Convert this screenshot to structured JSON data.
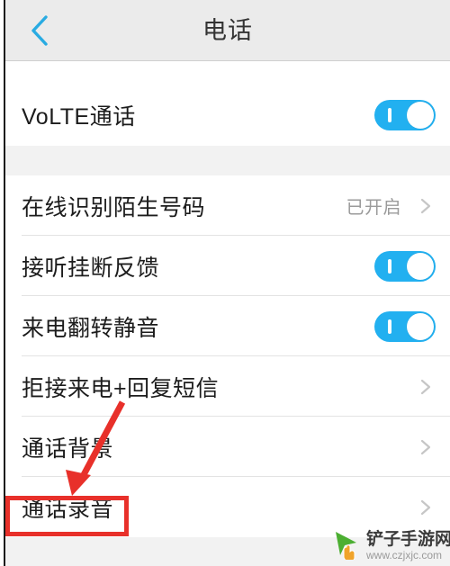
{
  "header": {
    "title": "电话",
    "back_icon": "chevron-left-icon",
    "accent_color": "#29abe2",
    "background_color": "#ebebeb"
  },
  "colors": {
    "toggle_on": "#22b0f0",
    "annotation_red": "#e8302a",
    "value_gray": "#9b9b9b",
    "label_dark": "#1c1c1c",
    "group_gap": "#f2f2f2"
  },
  "groups": [
    {
      "name": "volte-group",
      "rows": [
        {
          "label": "VoLTE通话",
          "control": "toggle",
          "toggle_state": "on",
          "value": "",
          "name": "row-volte-call"
        }
      ]
    },
    {
      "name": "call-settings-group",
      "rows": [
        {
          "label": "在线识别陌生号码",
          "control": "value-chevron",
          "value": "已开启",
          "name": "row-online-identify-stranger-number"
        },
        {
          "label": "接听挂断反馈",
          "control": "toggle",
          "toggle_state": "on",
          "value": "",
          "name": "row-answer-hangup-feedback"
        },
        {
          "label": "来电翻转静音",
          "control": "toggle",
          "toggle_state": "on",
          "value": "",
          "name": "row-flip-to-mute"
        },
        {
          "label": "拒接来电+回复短信",
          "control": "chevron",
          "value": "",
          "name": "row-reject-call-reply-sms"
        },
        {
          "label": "通话背景",
          "control": "chevron",
          "value": "",
          "name": "row-call-background"
        },
        {
          "label": "通话录音",
          "control": "chevron",
          "value": "",
          "name": "row-call-recording",
          "highlighted": true
        }
      ]
    }
  ],
  "annotations": {
    "highlight_target": "通话录音",
    "arrow_icon": "red-arrow-down-left-icon",
    "box_icon": "red-highlight-box"
  },
  "watermark": {
    "site_name": "铲子手游网",
    "url": "www.czjxjc.com",
    "logo_icon": "green-cursor-play-icon"
  }
}
